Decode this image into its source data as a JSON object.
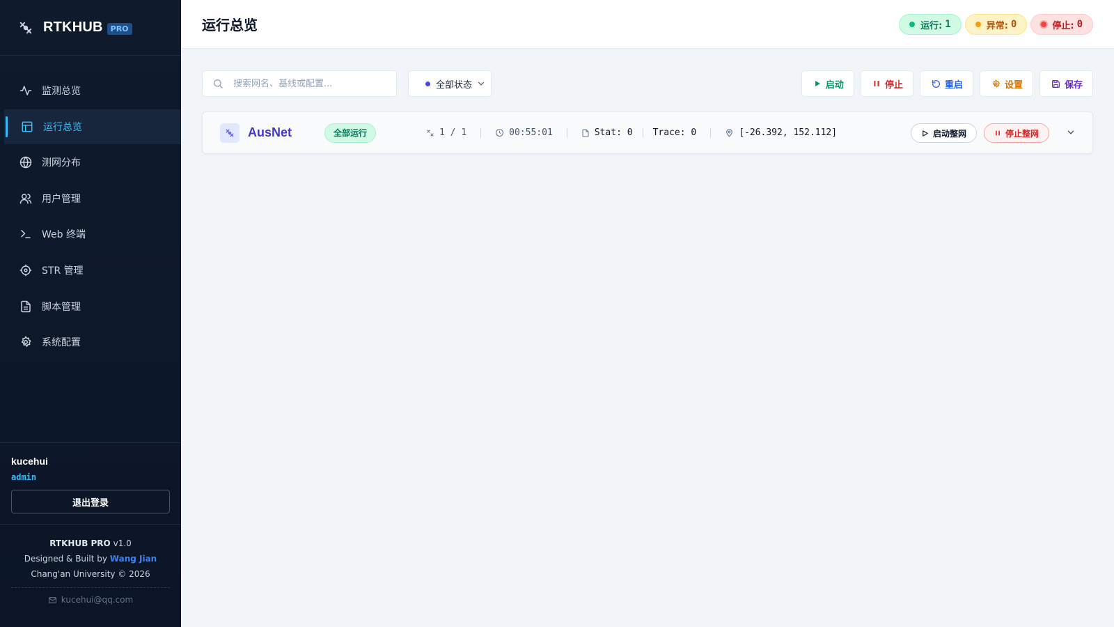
{
  "brand": {
    "name": "RTKHUB",
    "badge": "PRO",
    "icon": "satellite-icon"
  },
  "sidebar": {
    "items": [
      {
        "label": "监测总览",
        "icon": "activity-icon"
      },
      {
        "label": "运行总览",
        "icon": "layout-icon",
        "active": true
      },
      {
        "label": "测网分布",
        "icon": "globe-icon"
      },
      {
        "label": "用户管理",
        "icon": "users-icon"
      },
      {
        "label": "Web 终端",
        "icon": "terminal-icon"
      },
      {
        "label": "STR 管理",
        "icon": "target-icon"
      },
      {
        "label": "脚本管理",
        "icon": "file-text-icon"
      },
      {
        "label": "系统配置",
        "icon": "gear-icon"
      }
    ]
  },
  "user": {
    "name": "kucehui",
    "role": "admin",
    "logout_label": "退出登录"
  },
  "footer": {
    "product": "RTKHUB PRO",
    "version": "v1.0",
    "designed_prefix": "Designed & Built by",
    "author": "Wang Jian",
    "org": "Chang'an University © 2026",
    "email": "kucehui@qq.com"
  },
  "header": {
    "title": "运行总览",
    "badges": {
      "running_label": "运行:",
      "running_count": "1",
      "abnormal_label": "异常:",
      "abnormal_count": "0",
      "stopped_label": "停止:",
      "stopped_count": "0"
    }
  },
  "toolbar": {
    "search_placeholder": "搜索网名、基线或配置...",
    "status_filter": "全部状态",
    "start_label": "启动",
    "stop_label": "停止",
    "restart_label": "重启",
    "settings_label": "设置",
    "save_label": "保存"
  },
  "networks": [
    {
      "name": "AusNet",
      "status": "全部运行",
      "ratio": "1 / 1",
      "uptime": "00:55:01",
      "stat": "Stat: 0",
      "trace": "Trace: 0",
      "coords": "[-26.392, 152.112]",
      "start_all_label": "启动整网",
      "stop_all_label": "停止整网"
    }
  ],
  "colors": {
    "sidebar_bg": "#0f1b2d",
    "accent": "#38bdf8",
    "running": "#10b981",
    "warning": "#f59e0b",
    "danger": "#ef4444",
    "network_name": "#4338ca"
  }
}
